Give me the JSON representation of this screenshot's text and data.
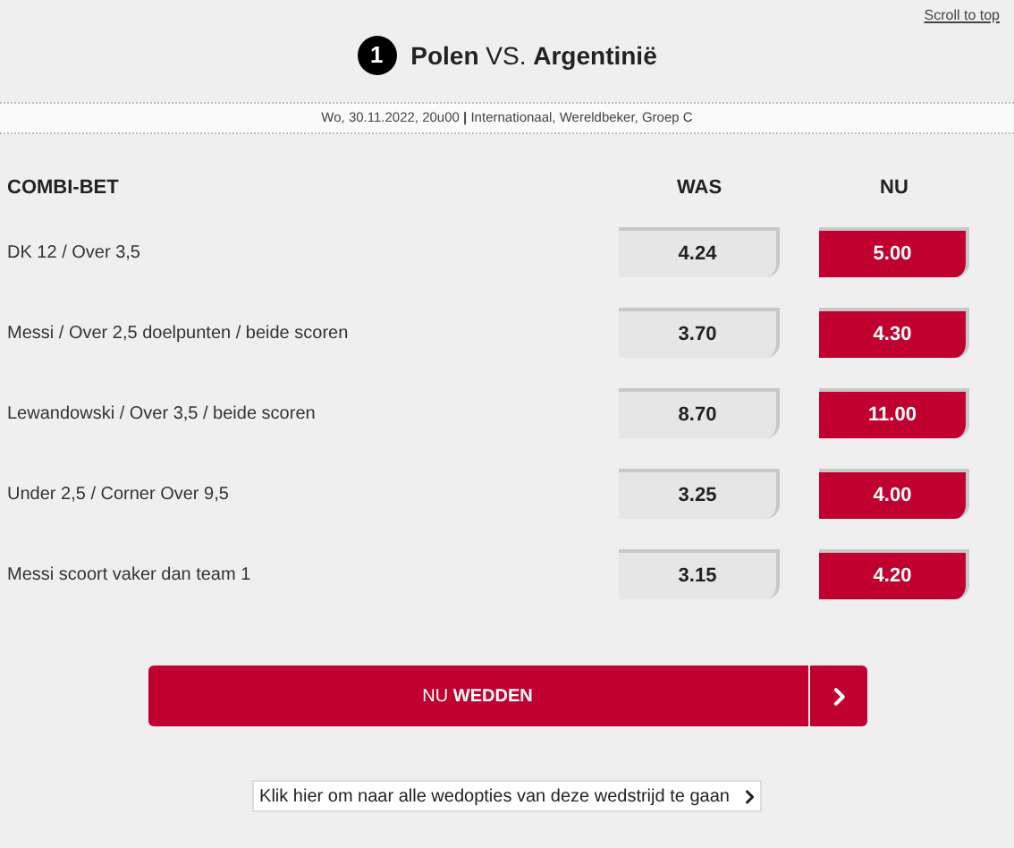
{
  "scroll_link": "Scroll to top",
  "match": {
    "number": "1",
    "title": "**Polen** VS. **Argentinië**",
    "info": "Wo, 30.11.2022, 20u00 **|** Internationaal, Wereldbeker, Groep C"
  },
  "table": {
    "columns": [
      "COMBI-BET",
      "WAS",
      "NU"
    ],
    "rows": [
      {
        "bet": "DK 12 / Over 3,5",
        "was": "4.24",
        "nu": "5.00"
      },
      {
        "bet": "Messi / Over 2,5 doelpunten / beide scoren",
        "was": "3.70",
        "nu": "4.30"
      },
      {
        "bet": "Lewandowski / Over 3,5 / beide scoren",
        "was": "8.70",
        "nu": "11.00"
      },
      {
        "bet": "Under 2,5 / Corner Over 9,5",
        "was": "3.25",
        "nu": "4.00"
      },
      {
        "bet": "Messi scoort vaker dan team 1",
        "was": "3.15",
        "nu": "4.20"
      }
    ]
  },
  "bet_button": "NU **WEDDEN**",
  "all_options_link": "Klik hier om naar alle wedopties van deze wedstrijd te gaan"
}
